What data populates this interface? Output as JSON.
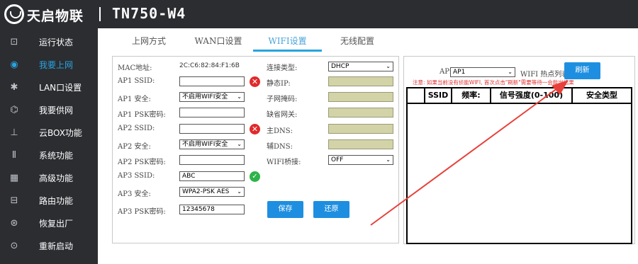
{
  "header": {
    "brand": "天启物联",
    "model": "TN750-W4"
  },
  "sidebar": {
    "items": [
      {
        "label": "运行状态",
        "icon": "monitor-icon",
        "glyph": "⊡"
      },
      {
        "label": "我要上网",
        "icon": "globe-icon",
        "glyph": "◉",
        "active": true
      },
      {
        "label": "LAN口设置",
        "icon": "gear-icon",
        "glyph": "✱"
      },
      {
        "label": "我要供网",
        "icon": "antenna-icon",
        "glyph": "⌬"
      },
      {
        "label": "云BOX功能",
        "icon": "network-tree-icon",
        "glyph": "⊥"
      },
      {
        "label": "系统功能",
        "icon": "wrench-icon",
        "glyph": "Ⅱ"
      },
      {
        "label": "高级功能",
        "icon": "grid-icon",
        "glyph": "▦"
      },
      {
        "label": "路由功能",
        "icon": "router-icon",
        "glyph": "⊟"
      },
      {
        "label": "恢复出厂",
        "icon": "restore-icon",
        "glyph": "⊛"
      },
      {
        "label": "重新启动",
        "icon": "reboot-icon",
        "glyph": "⊙"
      }
    ]
  },
  "tabs": [
    {
      "label": "上网方式"
    },
    {
      "label": "WAN口设置"
    },
    {
      "label": "WIFI设置",
      "active": true
    },
    {
      "label": "无线配置"
    }
  ],
  "form": {
    "mac_label": "MAC地址:",
    "mac_value": "2C:C6:82:84:F1:6B",
    "ap1_ssid_label": "AP1 SSID:",
    "ap1_ssid_value": "",
    "ap1_security_label": "AP1 安全:",
    "ap1_security_value": "不启用WIFI安全",
    "ap1_psk_label": "AP1 PSK密码:",
    "ap1_psk_value": "",
    "ap2_ssid_label": "AP2 SSID:",
    "ap2_ssid_value": "",
    "ap2_security_label": "AP2 安全:",
    "ap2_security_value": "不启用WIFI安全",
    "ap2_psk_label": "AP2 PSK密码:",
    "ap2_psk_value": "",
    "ap3_ssid_label": "AP3 SSID:",
    "ap3_ssid_value": "ABC",
    "ap3_security_label": "AP3 安全:",
    "ap3_security_value": "WPA2-PSK AES",
    "ap3_psk_label": "AP3 PSK密码:",
    "ap3_psk_value": "12345678",
    "conn_type_label": "连接类型:",
    "conn_type_value": "DHCP",
    "static_ip_label": "静态IP:",
    "subnet_label": "子网掩码:",
    "gateway_label": "缺省网关:",
    "dns1_label": "主DNS:",
    "dns2_label": "辅DNS:",
    "bridge_label": "WIFI桥接:",
    "bridge_value": "OFF",
    "save_label": "保存",
    "restore_label": "还原"
  },
  "scan": {
    "ap_label": "AP:",
    "ap_value": "AP1",
    "list_label": "WIFI 热点列表",
    "refresh_label": "刷新",
    "note": "注意: 如果当前没有侦能WIFI, 首次点击\"刷新\"需要等待一会能出结果",
    "columns": [
      "SSID",
      "频率:",
      "信号强度(0-100)",
      "安全类型"
    ]
  },
  "colors": {
    "accent": "#29a3e0",
    "sidebar_bg": "#2b2d31",
    "button": "#1e8fe0",
    "error": "#e02a2a",
    "ok": "#2db34a",
    "arrow": "#e8403a"
  }
}
